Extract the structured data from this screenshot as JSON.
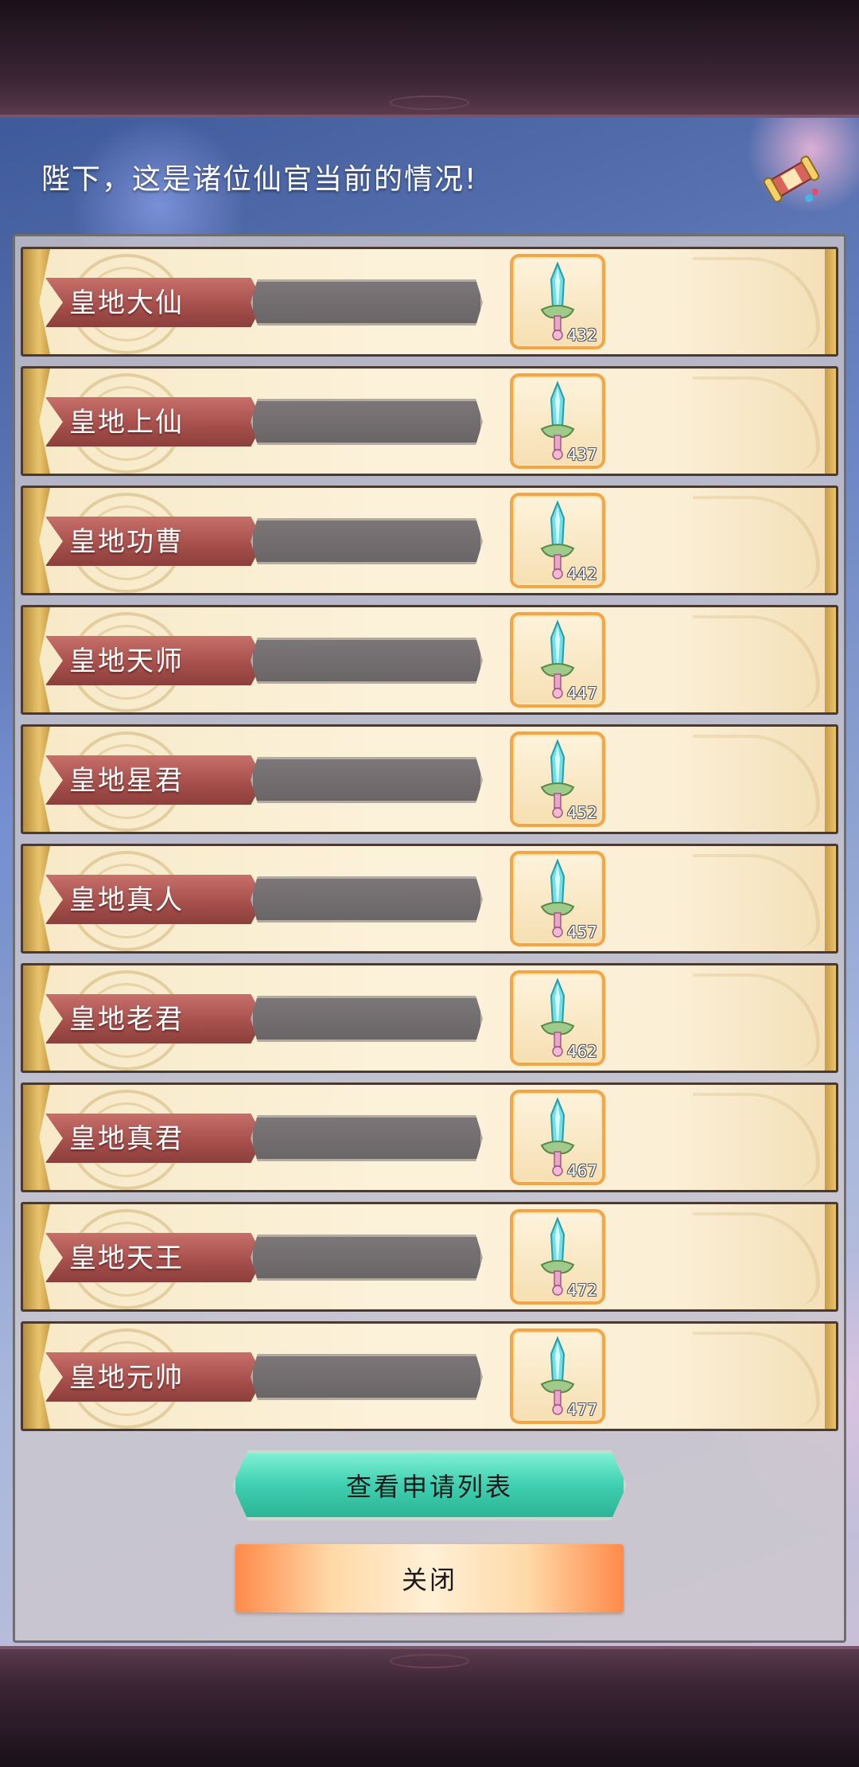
{
  "header": {
    "message": "陛下，这是诸位仙官当前的情况!"
  },
  "rows": [
    {
      "title": "皇地大仙",
      "count": "432"
    },
    {
      "title": "皇地上仙",
      "count": "437"
    },
    {
      "title": "皇地功曹",
      "count": "442"
    },
    {
      "title": "皇地天师",
      "count": "447"
    },
    {
      "title": "皇地星君",
      "count": "452"
    },
    {
      "title": "皇地真人",
      "count": "457"
    },
    {
      "title": "皇地老君",
      "count": "462"
    },
    {
      "title": "皇地真君",
      "count": "467"
    },
    {
      "title": "皇地天王",
      "count": "472"
    },
    {
      "title": "皇地元帅",
      "count": "477"
    }
  ],
  "buttons": {
    "view_applications": "查看申请列表",
    "close": "关闭"
  },
  "icons": {
    "scroll": "scroll-icon",
    "item": "sword-icon"
  }
}
